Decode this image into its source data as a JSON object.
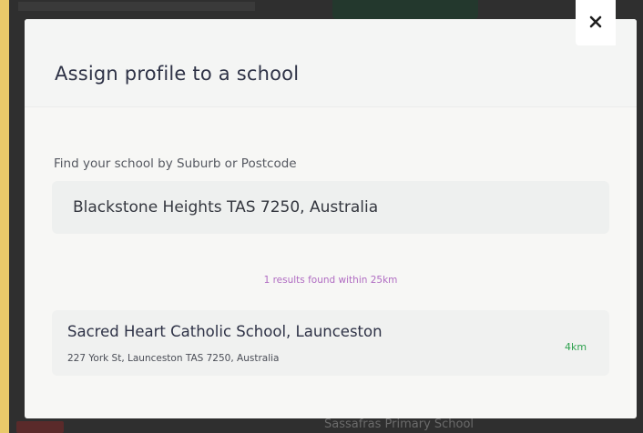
{
  "background": {
    "footer_text": "Sassafras Primary School"
  },
  "modal": {
    "title": "Assign profile to a school",
    "close_icon": "close-icon",
    "search": {
      "label": "Find your school by Suburb or Postcode",
      "value": "Blackstone Heights TAS 7250, Australia"
    },
    "results_summary": "1 results found within 25km",
    "results": [
      {
        "name": "Sacred Heart Catholic School, Launceston",
        "address": "227 York St, Launceston TAS 7250, Australia",
        "distance": "4km"
      }
    ]
  },
  "colors": {
    "accent_purple": "#b06cc2",
    "distance_green": "#2fa24f",
    "title_navy": "#2e3246"
  }
}
